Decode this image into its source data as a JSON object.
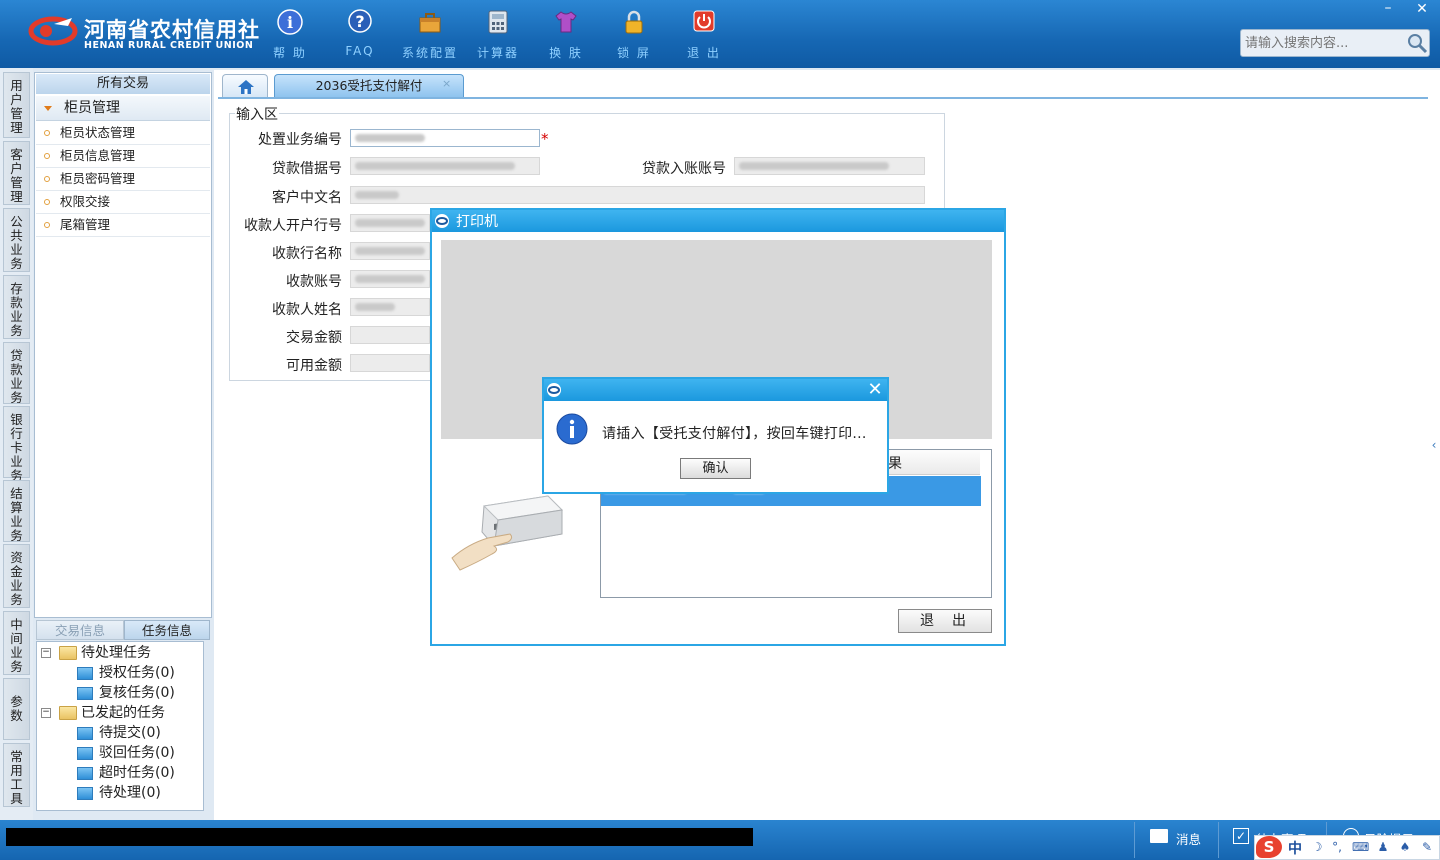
{
  "brand": {
    "name_cn": "河南省农村信用社",
    "name_en": "HENAN RURAL CREDIT UNION"
  },
  "toolbar": [
    {
      "label": "帮 助",
      "icon": "info-icon"
    },
    {
      "label": "FAQ",
      "icon": "question-icon"
    },
    {
      "label": "系统配置",
      "icon": "toolbox-icon"
    },
    {
      "label": "计算器",
      "icon": "calculator-icon"
    },
    {
      "label": "换 肤",
      "icon": "tshirt-icon"
    },
    {
      "label": "锁 屏",
      "icon": "lock-icon"
    },
    {
      "label": "退 出",
      "icon": "power-icon"
    }
  ],
  "window_controls": {
    "minimize": "–",
    "close": "✕"
  },
  "search": {
    "placeholder": "请输入搜索内容..."
  },
  "vertical_tabs": [
    "用户管理",
    "客户管理",
    "公共业务",
    "存款业务",
    "贷款业务",
    "银行卡业务",
    "结算业务",
    "资金业务",
    "中间业务",
    "参数",
    "常用工具"
  ],
  "nav": {
    "header": "所有交易",
    "group": "柜员管理",
    "items": [
      "柜员状态管理",
      "柜员信息管理",
      "柜员密码管理",
      "权限交接",
      "尾箱管理"
    ]
  },
  "task_panel": {
    "tabs": [
      "交易信息",
      "任务信息"
    ],
    "tree": [
      {
        "label": "待处理任务",
        "children": [
          "授权任务(0)",
          "复核任务(0)"
        ]
      },
      {
        "label": "已发起的任务",
        "children": [
          "待提交(0)",
          "驳回任务(0)",
          "超时任务(0)",
          "待处理(0)"
        ]
      }
    ]
  },
  "tabs": {
    "active": "2036受托支付解付",
    "close": "×"
  },
  "form": {
    "legend": "输入区",
    "required_mark": "*",
    "fields": {
      "biz_no": "处置业务编号",
      "loan_no": "贷款借据号",
      "loan_account": "贷款入账账号",
      "customer_name": "客户中文名",
      "payee_bank_code": "收款人开户行号",
      "payee_bank_name": "收款行名称",
      "payee_account": "收款账号",
      "payee_name": "收款人姓名",
      "amount": "交易金额",
      "available": "可用金额"
    }
  },
  "printer_dialog": {
    "title": "打印机",
    "list_header": "果",
    "exit_label": "退出"
  },
  "message_box": {
    "text": "请插入【受托支付解付】，按回车键打印...",
    "ok_label": "确认",
    "close": "✕"
  },
  "status_bar": {
    "messages": "消息",
    "todo": "待办事项",
    "risk": "风险提示"
  },
  "ime": {
    "logo": "S",
    "lang": "中"
  },
  "colors": {
    "title_bar": "#1b98de",
    "header": "#1667b3",
    "selection": "#3a99e5",
    "required": "#d40000"
  }
}
